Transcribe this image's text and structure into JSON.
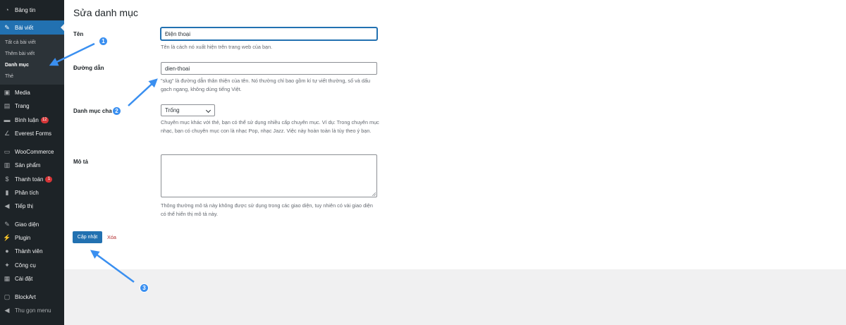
{
  "sidebar": {
    "dashboard": "Bảng tin",
    "posts": "Bài viết",
    "posts_sub": {
      "all": "Tất cả bài viết",
      "add": "Thêm bài viết",
      "categories": "Danh mục",
      "tags": "Thẻ"
    },
    "media": "Media",
    "pages": "Trang",
    "comments": "Bình luận",
    "comments_badge": "12",
    "everest_forms": "Everest Forms",
    "woocommerce": "WooCommerce",
    "products": "Sản phẩm",
    "payments": "Thanh toán",
    "payments_badge": "1",
    "analytics": "Phân tích",
    "marketing": "Tiếp thị",
    "appearance": "Giao diện",
    "plugins": "Plugin",
    "users": "Thành viên",
    "tools": "Công cụ",
    "settings": "Cài đặt",
    "blockart": "BlockArt",
    "collapse": "Thu gọn menu"
  },
  "page": {
    "title": "Sửa danh mục"
  },
  "form": {
    "name_label": "Tên",
    "name_value": "Điện thoại",
    "name_desc": "Tên là cách nó xuất hiện trên trang web của bạn.",
    "slug_label": "Đường dẫn",
    "slug_value": "dien-thoai",
    "slug_desc": "\"slug\" là đường dẫn thân thiện của tên. Nó thường chỉ bao gồm kí tự viết thường, số và dấu gạch ngang, không dùng tiếng Việt.",
    "parent_label": "Danh mục cha",
    "parent_value": "Trống",
    "parent_desc": "Chuyên mục khác với thẻ, bạn có thể sử dụng nhiều cấp chuyên mục. Ví dụ: Trong chuyên mục nhạc, bạn có chuyên mục con là nhạc Pop, nhạc Jazz. Việc này hoàn toàn là tùy theo ý bạn.",
    "desc_label": "Mô tả",
    "desc_value": "",
    "desc_desc": "Thông thường mô tả này không được sử dụng trong các giao diện, tuy nhiên có vài giao diện có thể hiển thị mô tả này.",
    "update_button": "Cập nhật",
    "delete_link": "Xóa"
  },
  "annotations": {
    "step1": "1",
    "step2": "2",
    "step3": "3",
    "color": "#3a8ff0"
  },
  "colors": {
    "admin_bar": "#1d2327",
    "accent": "#2271b1",
    "badge": "#d63638"
  }
}
